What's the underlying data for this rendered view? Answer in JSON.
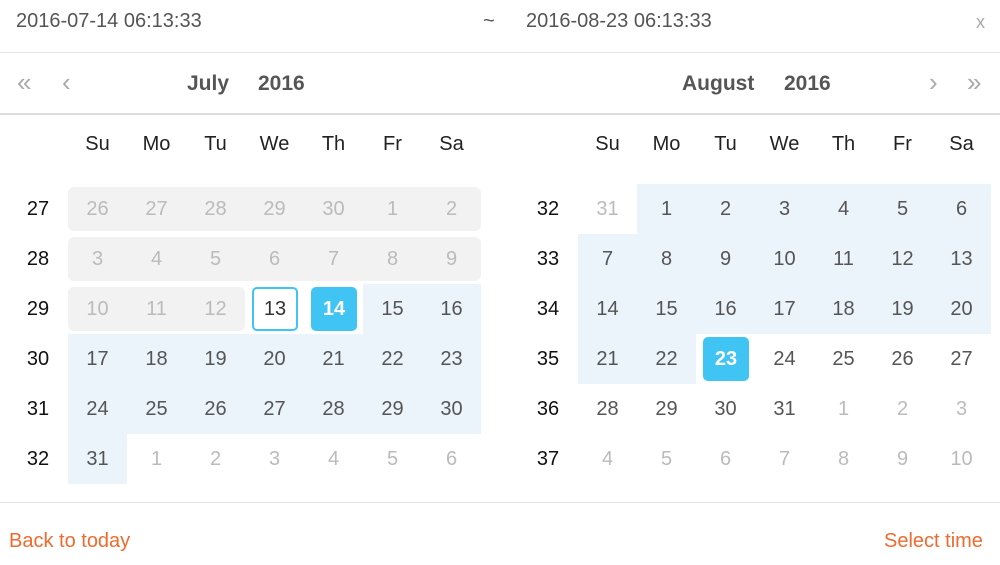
{
  "range": {
    "start": "2016-07-14 06:13:33",
    "separator": "~",
    "end": "2016-08-23 06:13:33",
    "clear": "x"
  },
  "nav": {
    "prev_year": "«",
    "prev_month": "‹",
    "next_month": "›",
    "next_year": "»"
  },
  "weekdays": [
    "Su",
    "Mo",
    "Tu",
    "We",
    "Th",
    "Fr",
    "Sa"
  ],
  "colors": {
    "accent": "#40c4f4",
    "range_bg": "#ebf4fa",
    "disabled_bg": "#f2f2f2",
    "link": "#f06a2e"
  },
  "calendars": [
    {
      "month": "July",
      "year": "2016",
      "weeks": [
        {
          "num": "27",
          "days": [
            [
              "26",
              "d"
            ],
            [
              "27",
              "d"
            ],
            [
              "28",
              "d"
            ],
            [
              "29",
              "d"
            ],
            [
              "30",
              "d"
            ],
            [
              "1",
              "d"
            ],
            [
              "2",
              "d"
            ]
          ]
        },
        {
          "num": "28",
          "days": [
            [
              "3",
              "d"
            ],
            [
              "4",
              "d"
            ],
            [
              "5",
              "d"
            ],
            [
              "6",
              "d"
            ],
            [
              "7",
              "d"
            ],
            [
              "8",
              "d"
            ],
            [
              "9",
              "d"
            ]
          ]
        },
        {
          "num": "29",
          "days": [
            [
              "10",
              "d"
            ],
            [
              "11",
              "d"
            ],
            [
              "12",
              "d"
            ],
            [
              "13",
              "t"
            ],
            [
              "14",
              "s"
            ],
            [
              "15",
              "r"
            ],
            [
              "16",
              "r"
            ]
          ]
        },
        {
          "num": "30",
          "days": [
            [
              "17",
              "r"
            ],
            [
              "18",
              "r"
            ],
            [
              "19",
              "r"
            ],
            [
              "20",
              "r"
            ],
            [
              "21",
              "r"
            ],
            [
              "22",
              "r"
            ],
            [
              "23",
              "r"
            ]
          ]
        },
        {
          "num": "31",
          "days": [
            [
              "24",
              "r"
            ],
            [
              "25",
              "r"
            ],
            [
              "26",
              "r"
            ],
            [
              "27",
              "r"
            ],
            [
              "28",
              "r"
            ],
            [
              "29",
              "r"
            ],
            [
              "30",
              "r"
            ]
          ]
        },
        {
          "num": "32",
          "days": [
            [
              "31",
              "r"
            ],
            [
              "1",
              "o"
            ],
            [
              "2",
              "o"
            ],
            [
              "3",
              "o"
            ],
            [
              "4",
              "o"
            ],
            [
              "5",
              "o"
            ],
            [
              "6",
              "o"
            ]
          ]
        }
      ]
    },
    {
      "month": "August",
      "year": "2016",
      "weeks": [
        {
          "num": "32",
          "days": [
            [
              "31",
              "o"
            ],
            [
              "1",
              "r"
            ],
            [
              "2",
              "r"
            ],
            [
              "3",
              "r"
            ],
            [
              "4",
              "r"
            ],
            [
              "5",
              "r"
            ],
            [
              "6",
              "r"
            ]
          ]
        },
        {
          "num": "33",
          "days": [
            [
              "7",
              "r"
            ],
            [
              "8",
              "r"
            ],
            [
              "9",
              "r"
            ],
            [
              "10",
              "r"
            ],
            [
              "11",
              "r"
            ],
            [
              "12",
              "r"
            ],
            [
              "13",
              "r"
            ]
          ]
        },
        {
          "num": "34",
          "days": [
            [
              "14",
              "r"
            ],
            [
              "15",
              "r"
            ],
            [
              "16",
              "r"
            ],
            [
              "17",
              "r"
            ],
            [
              "18",
              "r"
            ],
            [
              "19",
              "r"
            ],
            [
              "20",
              "r"
            ]
          ]
        },
        {
          "num": "35",
          "days": [
            [
              "21",
              "r"
            ],
            [
              "22",
              "r"
            ],
            [
              "23",
              "s"
            ],
            [
              "24",
              "n"
            ],
            [
              "25",
              "n"
            ],
            [
              "26",
              "n"
            ],
            [
              "27",
              "n"
            ]
          ]
        },
        {
          "num": "36",
          "days": [
            [
              "28",
              "n"
            ],
            [
              "29",
              "n"
            ],
            [
              "30",
              "n"
            ],
            [
              "31",
              "n"
            ],
            [
              "1",
              "o"
            ],
            [
              "2",
              "o"
            ],
            [
              "3",
              "o"
            ]
          ]
        },
        {
          "num": "37",
          "days": [
            [
              "4",
              "o"
            ],
            [
              "5",
              "o"
            ],
            [
              "6",
              "o"
            ],
            [
              "7",
              "o"
            ],
            [
              "8",
              "o"
            ],
            [
              "9",
              "o"
            ],
            [
              "10",
              "o"
            ]
          ]
        }
      ]
    }
  ],
  "footer": {
    "back": "Back to today",
    "select": "Select time"
  }
}
